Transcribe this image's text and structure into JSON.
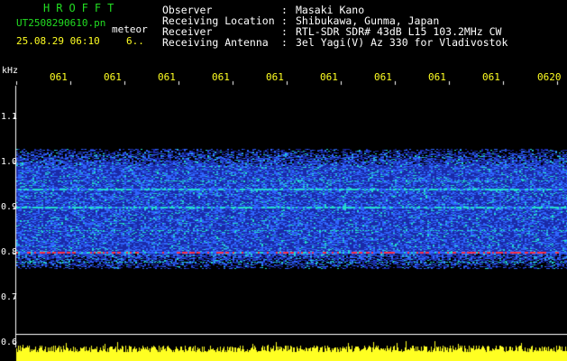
{
  "header": {
    "app_title": "HROFFT",
    "file_name": "UT2508290610.pn",
    "file_subtitle": "meteor",
    "timestamp": "25.08.29 06:10",
    "timestamp_extra": "6.."
  },
  "meta": [
    {
      "label": "Observer",
      "sep": ":",
      "value": "Masaki Kano"
    },
    {
      "label": "Receiving Location",
      "sep": ":",
      "value": "Shibukawa, Gunma, Japan"
    },
    {
      "label": "Receiver",
      "sep": ":",
      "value": "RTL-SDR SDR# 43dB L15 103.2MHz CW"
    },
    {
      "label": "Receiving Antenna",
      "sep": ":",
      "value": "3el Yagi(V) Az 330 for Vladivostok"
    }
  ],
  "chart_data": {
    "type": "heatmap",
    "ylabel": "kHz",
    "y_ticks": [
      "1.1",
      "1.0",
      "0.9",
      "0.8",
      "0.7",
      "0.6"
    ],
    "x_ticks": [
      "061",
      "061",
      "061",
      "061",
      "061",
      "061",
      "061",
      "061",
      "061",
      "0620"
    ],
    "ylim": [
      0.6,
      1.15
    ],
    "signal_band_khz": [
      0.765,
      1.03
    ],
    "strong_lines_khz": [
      0.8,
      0.9,
      0.94
    ],
    "colors": {
      "background": "#000000",
      "noise_low": "#1a2aa8",
      "noise_high": "#2f66ff",
      "line_mid": "#22ddcc",
      "line_strong": "#ff3344",
      "level_bar": "#ffff22",
      "axis_text": "#ffffff",
      "time_text": "#ffff22"
    }
  }
}
